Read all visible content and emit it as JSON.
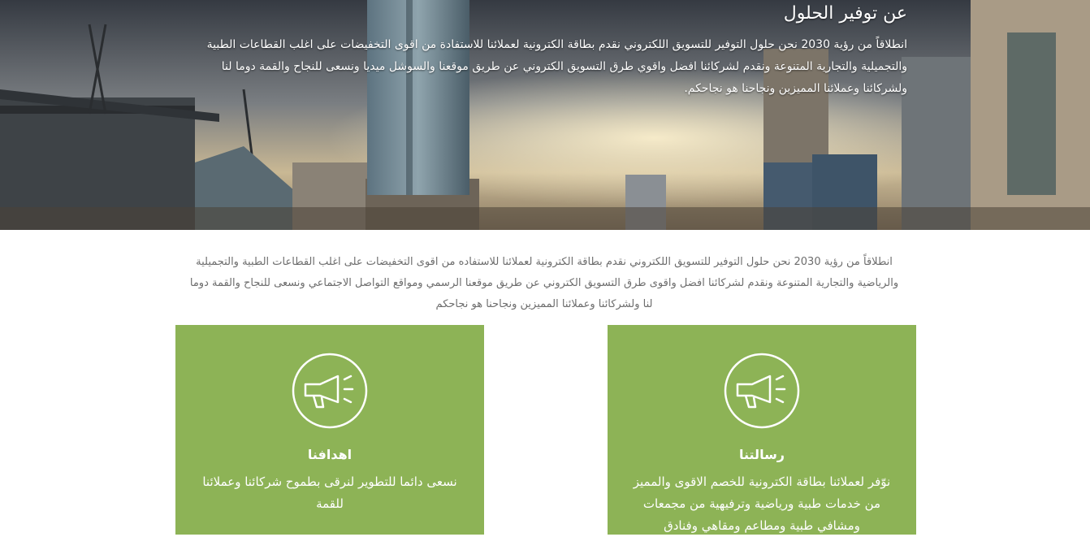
{
  "hero": {
    "title": "عن توفير الحلول",
    "body": "انطلاقاً من رؤية 2030 نحن حلول التوفير للتسويق اللكتروني نقدم بطاقة الكترونية لعملائنا للاستفادة من اقوى التخفيضات على اغلب القطاعات الطبية والتجميلية والتجارية المتنوعة ونقدم لشركائنا افضل واقوي طرق التسويق الكتروني عن طريق موقعنا والسوشل ميديا ونسعى للنجاح والقمة دوما لنا ولشركائنا وعملائنا المميزين ونجاحنا هو نجاحكم."
  },
  "intro": {
    "text": "انطلاقاً من رؤية 2030 نحن حلول التوفير للتسويق اللكتروني نقدم بطاقة الكترونية لعملائنا للاستفاده من اقوى التخفيضات على اغلب القطاعات الطبية والتجميلية والرياضية والتجارية المتنوعة ونقدم لشركائنا افضل واقوى طرق التسويق الكتروني عن طريق موقعنا الرسمي ومواقع التواصل الاجتماعي ونسعى للنجاح والقمة دوما لنا ولشركائنا وعملائنا المميزين ونجاحنا هو نجاحكم"
  },
  "cards": {
    "goals": {
      "title": "اهدافنا",
      "text": "نسعى دائما للتطوير لنرقى بطموح شركائنا وعملائنا للقمة",
      "icon": "megaphone-icon"
    },
    "mission": {
      "title": "رسالتنا",
      "text": "نوّفر لعملائنا بطاقة الكترونية للخصم الاقوى والمميز من خدمات طبية ورياضية وترفيهية من مجمعات ومشافي طبية ومطاعم ومقاهي وفنادق",
      "icon": "megaphone-icon"
    }
  },
  "colors": {
    "card_background": "#8db356",
    "text_light": "#ffffff",
    "intro_text": "#6d6d6d"
  }
}
